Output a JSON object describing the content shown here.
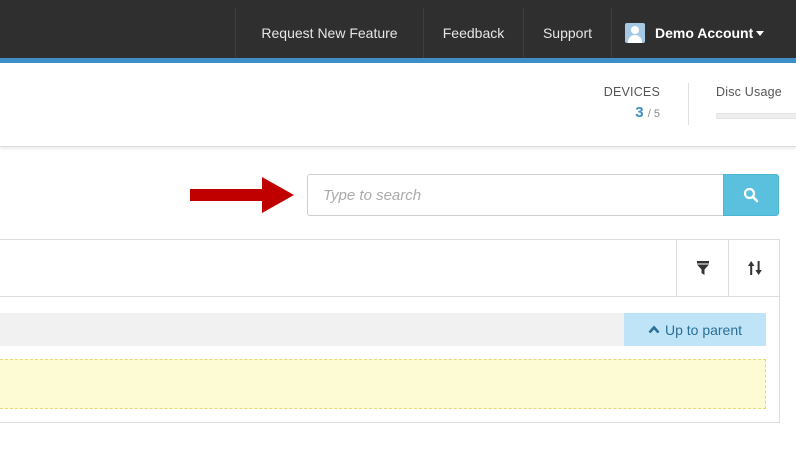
{
  "navbar": {
    "request_feature": "Request New Feature",
    "feedback": "Feedback",
    "support": "Support",
    "account": "Demo Account"
  },
  "stats": {
    "devices_label": "DEVICES",
    "devices_used": "3",
    "devices_total": "/ 5",
    "disc_label": "Disc Usage"
  },
  "search": {
    "placeholder": "Type to search"
  },
  "toolbar": {
    "filter_icon": "filter-icon",
    "sort_icon": "sort-icon"
  },
  "panel": {
    "up_to_parent": "Up to parent"
  },
  "colors": {
    "navbar_bg": "#2f2f2f",
    "accent": "#3d8fc6",
    "search_button": "#5bc0de",
    "arrow": "#c00000",
    "up_parent_bg": "#bfe3f7",
    "drop_zone_bg": "#fdfbd4"
  }
}
